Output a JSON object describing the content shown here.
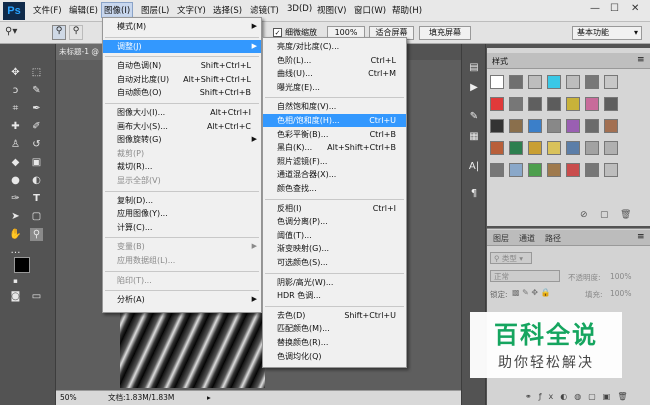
{
  "app": {
    "logo": "Ps",
    "doc_tab": "未标题-1 @",
    "status_zoom": "50%",
    "status_doc": "文档:1.83M/1.83M"
  },
  "menubar": [
    "文件(F)",
    "编辑(E)",
    "图像(I)",
    "图层(L)",
    "文字(Y)",
    "选择(S)",
    "滤镜(T)",
    "3D(D)",
    "视图(V)",
    "窗口(W)",
    "帮助(H)"
  ],
  "window_controls": [
    "—",
    "☐",
    "✕"
  ],
  "options": {
    "checkbox_label": "细微缩放",
    "zoom_value": "100%",
    "fit_screen": "适合屏幕",
    "fill_screen": "填充屏幕",
    "workspace": "基本功能"
  },
  "image_menu": [
    {
      "label": "模式(M)",
      "arrow": true
    },
    {
      "sep": true
    },
    {
      "label": "调整(J)",
      "arrow": true,
      "hl": true
    },
    {
      "sep": true
    },
    {
      "label": "自动色调(N)",
      "sc": "Shift+Ctrl+L"
    },
    {
      "label": "自动对比度(U)",
      "sc": "Alt+Shift+Ctrl+L"
    },
    {
      "label": "自动颜色(O)",
      "sc": "Shift+Ctrl+B"
    },
    {
      "sep": true
    },
    {
      "label": "图像大小(I)...",
      "sc": "Alt+Ctrl+I"
    },
    {
      "label": "画布大小(S)...",
      "sc": "Alt+Ctrl+C"
    },
    {
      "label": "图像旋转(G)",
      "arrow": true
    },
    {
      "label": "裁剪(P)",
      "dis": true
    },
    {
      "label": "裁切(R)..."
    },
    {
      "label": "显示全部(V)",
      "dis": true
    },
    {
      "sep": true
    },
    {
      "label": "复制(D)..."
    },
    {
      "label": "应用图像(Y)..."
    },
    {
      "label": "计算(C)..."
    },
    {
      "sep": true
    },
    {
      "label": "变量(B)",
      "arrow": true,
      "dis": true
    },
    {
      "label": "应用数据组(L)...",
      "dis": true
    },
    {
      "sep": true
    },
    {
      "label": "陷印(T)...",
      "dis": true
    },
    {
      "sep": true
    },
    {
      "label": "分析(A)",
      "arrow": true
    }
  ],
  "adjust_menu": [
    {
      "label": "亮度/对比度(C)..."
    },
    {
      "label": "色阶(L)...",
      "sc": "Ctrl+L"
    },
    {
      "label": "曲线(U)...",
      "sc": "Ctrl+M"
    },
    {
      "label": "曝光度(E)..."
    },
    {
      "sep": true
    },
    {
      "label": "自然饱和度(V)..."
    },
    {
      "label": "色相/饱和度(H)...",
      "sc": "Ctrl+U",
      "hl": true
    },
    {
      "label": "色彩平衡(B)...",
      "sc": "Ctrl+B"
    },
    {
      "label": "黑白(K)...",
      "sc": "Alt+Shift+Ctrl+B"
    },
    {
      "label": "照片滤镜(F)..."
    },
    {
      "label": "通道混合器(X)..."
    },
    {
      "label": "颜色查找..."
    },
    {
      "sep": true
    },
    {
      "label": "反相(I)",
      "sc": "Ctrl+I"
    },
    {
      "label": "色调分离(P)..."
    },
    {
      "label": "阈值(T)..."
    },
    {
      "label": "渐变映射(G)..."
    },
    {
      "label": "可选颜色(S)..."
    },
    {
      "sep": true
    },
    {
      "label": "阴影/高光(W)..."
    },
    {
      "label": "HDR 色调..."
    },
    {
      "sep": true
    },
    {
      "label": "去色(D)",
      "sc": "Shift+Ctrl+U"
    },
    {
      "label": "匹配颜色(M)..."
    },
    {
      "label": "替换颜色(R)..."
    },
    {
      "label": "色调均化(Q)"
    }
  ],
  "swatches": {
    "title": "样式",
    "colors": [
      "#ffffff",
      "#6f6f6f",
      "#bdbdbd",
      "#3ac8e6",
      "#bdbdbd",
      "#777777",
      "#c7c7c7",
      "#e03a3a",
      "#777777",
      "#5f5f5f",
      "#5c5c5c",
      "#c8b23a",
      "#c86b9a",
      "#5e5e5e",
      "#333333",
      "#8a6f4c",
      "#3b7fc9",
      "#888888",
      "#9a5fb2",
      "#6b6b6b",
      "#a37052",
      "#b85f3a",
      "#2d7f4f",
      "#c99f33",
      "#d9c25b",
      "#5c7ea8",
      "#a2a2a2",
      "#b0b0b0",
      "#777777",
      "#8aa8c9",
      "#4d9f4d",
      "#9f7a4d",
      "#c94d4d",
      "#777777",
      "#bdbdbd"
    ]
  },
  "layers": {
    "tabs": [
      "图层",
      "通道",
      "路径"
    ],
    "kind": "类型",
    "mode": "正常",
    "opacity_label": "不透明度:",
    "opacity": "100%",
    "lock_label": "锁定:",
    "fill_label": "填充:",
    "fill": "100%"
  },
  "watermark": {
    "title": "百科全说",
    "subtitle": "助你轻松解决"
  }
}
